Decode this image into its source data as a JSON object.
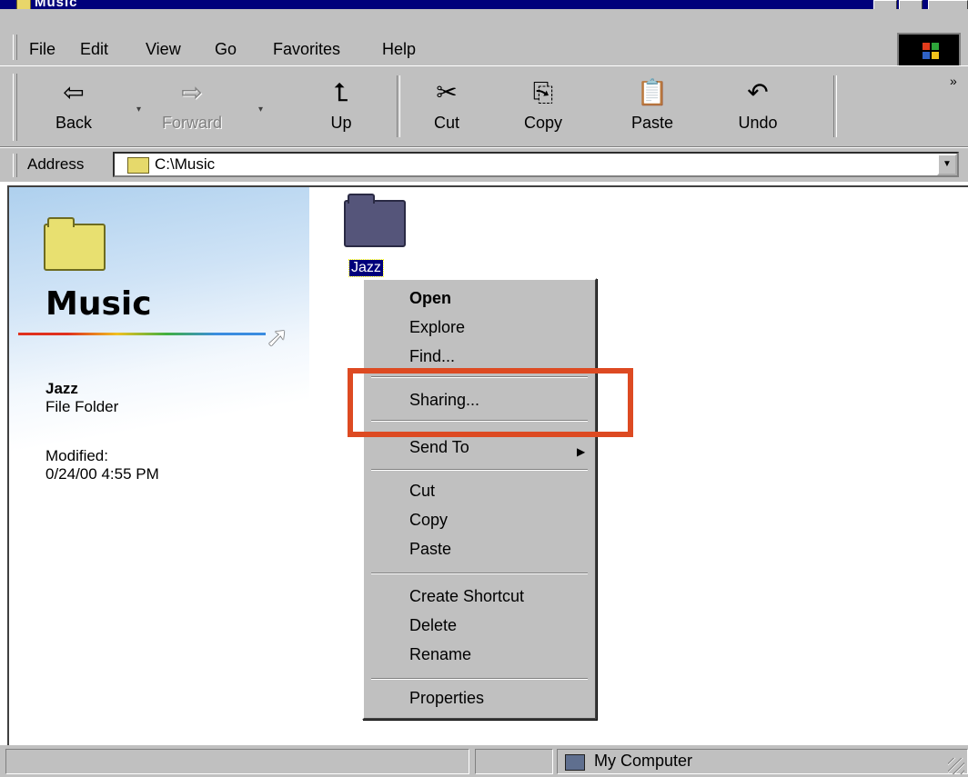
{
  "window": {
    "title": "Music"
  },
  "menubar": {
    "items": [
      {
        "label": "File",
        "u": "F"
      },
      {
        "label": "Edit",
        "u": "E"
      },
      {
        "label": "View",
        "u": "V"
      },
      {
        "label": "Go",
        "u": "G"
      },
      {
        "label": "Favorites",
        "u": "a"
      },
      {
        "label": "Help",
        "u": "H"
      }
    ]
  },
  "toolbar": {
    "back": "Back",
    "forward": "Forward",
    "up": "Up",
    "cut": "Cut",
    "copy": "Copy",
    "paste": "Paste",
    "undo": "Undo",
    "more": "»"
  },
  "address": {
    "label": "Address",
    "value": "C:\\Music"
  },
  "panel": {
    "title": "Music",
    "selected_name": "Jazz",
    "selected_type": "File Folder",
    "modified_label": "Modified:",
    "modified_value": "0/24/00 4:55 PM"
  },
  "folder": {
    "name": "Jazz"
  },
  "context_menu": {
    "open": "Open",
    "explore": "Explore",
    "find": "Find...",
    "sharing": "Sharing...",
    "send_to": "Send To",
    "cut": "Cut",
    "copy": "Copy",
    "paste": "Paste",
    "create_shortcut": "Create Shortcut",
    "delete": "Delete",
    "rename": "Rename",
    "properties": "Properties"
  },
  "statusbar": {
    "zone": "My Computer"
  },
  "colors": {
    "highlight": "#dd4a22",
    "titlebar": "#00007b",
    "chrome": "#c0c0c0"
  }
}
